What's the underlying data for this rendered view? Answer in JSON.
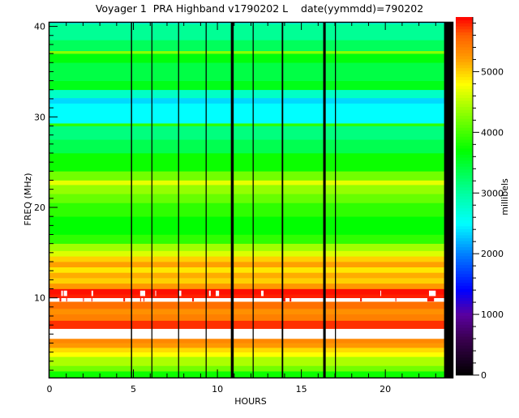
{
  "chart_data": {
    "type": "heatmap",
    "title": "Voyager 1  PRA Highband v1790202 L    date(yymmdd)=790202",
    "xlabel": "HOURS",
    "ylabel": "FREQ (MHz)",
    "xlim": [
      0,
      24
    ],
    "ylim": [
      1.2,
      40.5
    ],
    "x_ticks": [
      0,
      5,
      10,
      15,
      20
    ],
    "x_tick_labels": [
      "0",
      "5",
      "10",
      "15",
      "20"
    ],
    "y_ticks": [
      10,
      20,
      30,
      40
    ],
    "y_tick_labels": [
      "10",
      "20",
      "30",
      "40"
    ],
    "colorbar": {
      "label": "millibels",
      "range": [
        0,
        5900
      ],
      "ticks": [
        0,
        1000,
        2000,
        3000,
        4000,
        5000
      ],
      "tick_labels": [
        "0",
        "1000",
        "2000",
        "3000",
        "4000",
        "5000"
      ]
    },
    "colormap_stops": [
      [
        0,
        "#000000"
      ],
      [
        600,
        "#3a0050"
      ],
      [
        1000,
        "#5a00a0"
      ],
      [
        1400,
        "#0000ff"
      ],
      [
        2000,
        "#0080ff"
      ],
      [
        2500,
        "#00ffff"
      ],
      [
        3000,
        "#00ffa0"
      ],
      [
        3700,
        "#00ff00"
      ],
      [
        4400,
        "#a0ff00"
      ],
      [
        4800,
        "#ffff00"
      ],
      [
        5200,
        "#ffa000"
      ],
      [
        5600,
        "#ff6000"
      ],
      [
        5900,
        "#ff0000"
      ]
    ],
    "frequency_bands_mhz_millibels": [
      [
        1.2,
        1.9,
        3750
      ],
      [
        1.9,
        2.5,
        4200
      ],
      [
        2.5,
        3.5,
        4450
      ],
      [
        3.5,
        4.0,
        4800
      ],
      [
        4.0,
        4.5,
        4950
      ],
      [
        4.5,
        5.0,
        5250
      ],
      [
        5.0,
        5.5,
        5350
      ],
      [
        5.5,
        6.6,
        null
      ],
      [
        6.6,
        7.5,
        5750
      ],
      [
        7.5,
        8.2,
        5400
      ],
      [
        8.2,
        8.8,
        5300
      ],
      [
        8.8,
        9.6,
        5500
      ],
      [
        9.6,
        10.0,
        null
      ],
      [
        10.0,
        10.4,
        5800
      ],
      [
        10.4,
        11.0,
        5850
      ],
      [
        11.0,
        11.6,
        5250
      ],
      [
        11.6,
        12.2,
        5000
      ],
      [
        12.2,
        12.8,
        5150
      ],
      [
        12.8,
        13.4,
        4900
      ],
      [
        13.4,
        14.0,
        5200
      ],
      [
        14.0,
        14.6,
        5000
      ],
      [
        14.6,
        15.2,
        4650
      ],
      [
        15.2,
        16.0,
        4400
      ],
      [
        16.0,
        17.0,
        3900
      ],
      [
        17.0,
        19.0,
        3700
      ],
      [
        19.0,
        20.5,
        3900
      ],
      [
        20.5,
        21.5,
        4150
      ],
      [
        21.5,
        22.5,
        4350
      ],
      [
        22.5,
        23.0,
        4700
      ],
      [
        23.0,
        24.0,
        4200
      ],
      [
        24.0,
        26.0,
        3750
      ],
      [
        26.0,
        27.5,
        3350
      ],
      [
        27.5,
        29.0,
        3150
      ],
      [
        29.0,
        29.3,
        3900
      ],
      [
        29.3,
        31.5,
        2500
      ],
      [
        31.5,
        32.1,
        2350
      ],
      [
        32.1,
        33.0,
        2800
      ],
      [
        33.0,
        34.0,
        3600
      ],
      [
        34.0,
        36.0,
        3400
      ],
      [
        36.0,
        37.0,
        3650
      ],
      [
        37.0,
        37.3,
        4300
      ],
      [
        37.3,
        38.5,
        3300
      ],
      [
        38.5,
        40.3,
        3050
      ],
      [
        40.3,
        40.5,
        2600
      ]
    ],
    "data_gaps_hours": [
      [
        4.85,
        4.92
      ],
      [
        6.07,
        6.12
      ],
      [
        7.66,
        7.72
      ],
      [
        9.3,
        9.36
      ],
      [
        10.8,
        10.97
      ],
      [
        12.1,
        12.16
      ],
      [
        13.83,
        13.92
      ],
      [
        16.3,
        16.45
      ],
      [
        17.0,
        17.06
      ],
      [
        23.5,
        24.0
      ]
    ],
    "red_breaks_in_white_row_hours": [
      [
        0.6,
        0.7
      ],
      [
        1.0,
        1.05
      ],
      [
        2.0,
        2.05
      ],
      [
        2.5,
        2.55
      ],
      [
        4.4,
        4.5
      ],
      [
        5.4,
        5.45
      ],
      [
        5.6,
        5.65
      ],
      [
        8.5,
        8.6
      ],
      [
        13.9,
        14.05
      ],
      [
        14.3,
        14.4
      ],
      [
        18.5,
        18.6
      ],
      [
        20.6,
        20.65
      ],
      [
        22.5,
        22.9
      ]
    ],
    "white_flecks_hours": [
      [
        0.7,
        0.8
      ],
      [
        0.85,
        1.05
      ],
      [
        2.5,
        2.6
      ],
      [
        5.4,
        5.7
      ],
      [
        6.3,
        6.35
      ],
      [
        7.7,
        7.85
      ],
      [
        9.5,
        9.6
      ],
      [
        9.9,
        10.1
      ],
      [
        12.6,
        12.75
      ],
      [
        19.7,
        19.75
      ],
      [
        22.6,
        23.0
      ]
    ]
  }
}
